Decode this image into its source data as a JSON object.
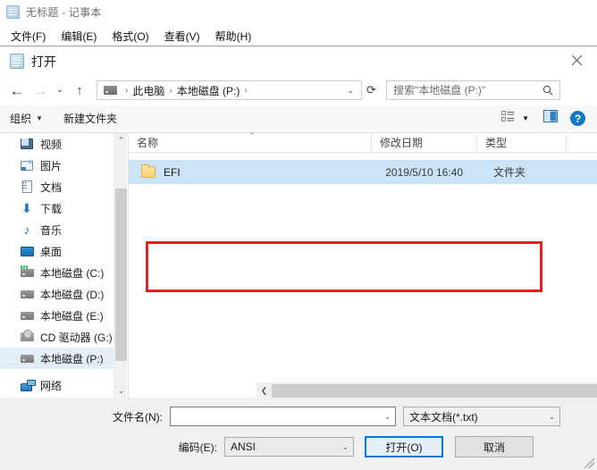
{
  "notepad": {
    "title": "无标题 - 记事本",
    "icon": "notepad-icon",
    "menus": [
      {
        "label": "文件(F)"
      },
      {
        "label": "编辑(E)"
      },
      {
        "label": "格式(O)"
      },
      {
        "label": "查看(V)"
      },
      {
        "label": "帮助(H)"
      }
    ]
  },
  "dialog": {
    "title": "打开",
    "icon": "notepad-icon",
    "close_label": "✕",
    "nav": {
      "back_icon": "arrow-left-icon",
      "forward_icon": "arrow-right-icon",
      "recent_icon": "chevron-down-icon",
      "up_icon": "arrow-up-icon",
      "refresh_icon": "refresh-icon",
      "breadcrumb": {
        "drive_icon": "drive-icon",
        "items": [
          "此电脑",
          "本地磁盘 (P:)"
        ],
        "separator": "›"
      },
      "search": {
        "placeholder": "搜索\"本地磁盘 (P:)\"",
        "value": "",
        "icon": "search-icon"
      }
    },
    "toolbar": {
      "organize_label": "组织",
      "organize_caret": "▼",
      "new_folder_label": "新建文件夹",
      "view_icon": "list-view-icon",
      "view_caret": "▼",
      "preview_icon": "preview-pane-icon",
      "help_icon": "help-icon",
      "help_glyph": "?"
    },
    "sidebar": {
      "items": [
        {
          "label": "视频",
          "icon": "video-folder-icon",
          "selected": false
        },
        {
          "label": "图片",
          "icon": "pictures-folder-icon",
          "selected": false
        },
        {
          "label": "文档",
          "icon": "documents-folder-icon",
          "selected": false
        },
        {
          "label": "下载",
          "icon": "downloads-folder-icon",
          "selected": false
        },
        {
          "label": "音乐",
          "icon": "music-folder-icon",
          "selected": false
        },
        {
          "label": "桌面",
          "icon": "desktop-folder-icon",
          "selected": false
        },
        {
          "label": "本地磁盘 (C:)",
          "icon": "system-drive-icon",
          "selected": false
        },
        {
          "label": "本地磁盘 (D:)",
          "icon": "drive-icon",
          "selected": false
        },
        {
          "label": "本地磁盘 (E:)",
          "icon": "drive-icon",
          "selected": false
        },
        {
          "label": "CD 驱动器 (G:)",
          "icon": "cd-drive-icon",
          "selected": false
        },
        {
          "label": "本地磁盘 (P:)",
          "icon": "drive-icon",
          "selected": true
        },
        {
          "label": "网络",
          "icon": "network-icon",
          "selected": false
        }
      ],
      "scrollbar": {
        "up_icon": "chevron-up-icon",
        "down_icon": "chevron-down-icon"
      }
    },
    "filelist": {
      "columns": [
        {
          "label": "名称",
          "sort_indicator": "⌃"
        },
        {
          "label": "修改日期"
        },
        {
          "label": "类型"
        }
      ],
      "rows": [
        {
          "name": "EFI",
          "date": "2019/5/10 16:40",
          "type": "文件夹",
          "icon": "folder-icon",
          "selected": true
        }
      ],
      "hscroll": {
        "left_icon": "chevron-left-icon",
        "right_icon": "chevron-right-icon"
      }
    },
    "annotation": {
      "color": "#e81e1e"
    },
    "footer": {
      "filename_label": "文件名(N):",
      "filename_value": "",
      "filename_caret": "⌄",
      "filetype_value": "文本文档(*.txt)",
      "filetype_caret": "⌄",
      "encoding_label": "编码(E):",
      "encoding_value": "ANSI",
      "encoding_caret": "⌄",
      "open_label": "打开(O)",
      "cancel_label": "取消"
    }
  },
  "colors": {
    "accent": "#0078d7",
    "selection": "#cce4f7",
    "sidebar_selection": "#e5eff9",
    "annotation": "#e81e1e",
    "help_blue": "#1479c4"
  }
}
